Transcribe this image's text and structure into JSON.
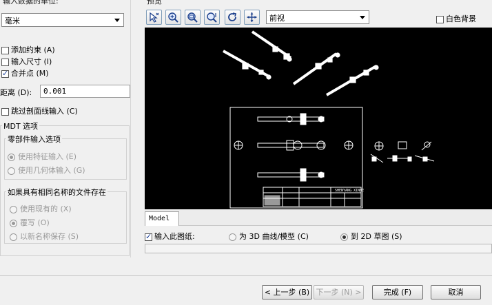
{
  "left": {
    "units_label": "输入数据的单位:",
    "units_value": "毫米",
    "add_constraints": "添加约束 (A)",
    "input_dimensions": "输入尺寸 (I)",
    "merge_points": "合并点 (M)",
    "distance_label": "距离 (D):",
    "distance_value": "0.001",
    "skip_section_lines": "跳过剖面线输入 (C)",
    "mdt_options_title": "MDT 选项",
    "part_input_title": "零部件输入选项",
    "use_feature_input": "使用特征输入 (E)",
    "use_geometry_input": "使用几何体输入 (G)",
    "file_exists_title": "如果具有相同名称的文件存在",
    "use_existing": "使用现有的 (X)",
    "overwrite": "覆写 (O)",
    "save_new_name": "以新名称保存 (S)"
  },
  "preview": {
    "label": "预览",
    "view_value": "前视",
    "white_bg_label": "白色背景",
    "model_tab": "Model",
    "drawing_title_text": "SHENYANG XINHE"
  },
  "bottom": {
    "input_this_drawing": "输入此图纸:",
    "to_3d": "为 3D 曲线/模型 (C)",
    "to_2d": "到 2D 草图 (S)"
  },
  "buttons": {
    "back": "< 上一步 (B)",
    "next": "下一步 (N) >",
    "finish": "完成 (F)",
    "cancel": "取消"
  },
  "state": {
    "add_constraints_checked": false,
    "input_dimensions_checked": false,
    "merge_points_checked": true,
    "skip_section_checked": false,
    "white_bg_checked": false,
    "input_this_drawing_checked": true,
    "selected_output": "to_2d",
    "part_input_selected": "use_feature_input",
    "file_exists_selected": "overwrite"
  },
  "icons": [
    "select-objects-icon",
    "zoom-in-icon",
    "zoom-window-icon",
    "zoom-extents-icon",
    "refresh-icon",
    "pan-icon"
  ]
}
